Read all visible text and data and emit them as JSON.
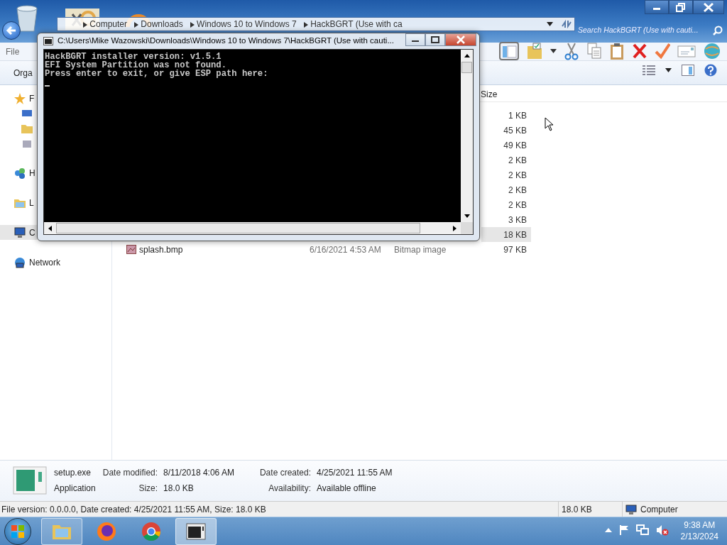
{
  "explorer": {
    "breadcrumb": [
      "Computer",
      "Downloads",
      "Windows 10 to Windows 7",
      "HackBGRT (Use with ca"
    ],
    "search": {
      "placeholder": "Search HackBGRT (Use with cauti..."
    },
    "menu": [
      "File"
    ],
    "toolbar": {
      "organize": "Orga"
    },
    "sidebar": [
      {
        "label": "F",
        "kind": "favorites",
        "selected": false
      },
      {
        "label": "H",
        "kind": "homegroup",
        "selected": false
      },
      {
        "label": "L",
        "kind": "libraries",
        "selected": false
      },
      {
        "label": "C",
        "kind": "computer",
        "selected": true
      },
      {
        "label": "Network",
        "kind": "network",
        "selected": false
      }
    ],
    "columns": [
      "Size"
    ],
    "rows": [
      {
        "size": "1 KB",
        "selected": false
      },
      {
        "size": "45 KB",
        "selected": false
      },
      {
        "size": "49 KB",
        "selected": false
      },
      {
        "size": "2 KB",
        "selected": false
      },
      {
        "size": "2 KB",
        "selected": false
      },
      {
        "size": "2 KB",
        "selected": false
      },
      {
        "size": "2 KB",
        "selected": false
      },
      {
        "size": "3 KB",
        "selected": false
      },
      {
        "size": "18 KB",
        "selected": true
      },
      {
        "name": "splash.bmp",
        "date": "6/16/2021 4:53 AM",
        "type": "Bitmap image",
        "size": "97 KB",
        "selected": false
      }
    ],
    "details": {
      "name": "setup.exe",
      "type": "Application",
      "fields": [
        {
          "label": "Date modified:",
          "value": "8/11/2018 4:06 AM"
        },
        {
          "label": "Size:",
          "value": "18.0 KB"
        },
        {
          "label": "Date created:",
          "value": "4/25/2021 11:55 AM"
        },
        {
          "label": "Availability:",
          "value": "Available offline"
        }
      ]
    },
    "status_bar": {
      "text": "File version: 0.0.0.0, Date created: 4/25/2021 11:55 AM, Size: 18.0 KB",
      "size": "18.0 KB",
      "zone": "Computer"
    }
  },
  "console": {
    "title": "C:\\Users\\Mike Wazowski\\Downloads\\Windows 10 to Windows 7\\HackBGRT (Use with cauti...",
    "lines": [
      "HackBGRT installer version: v1.5.1",
      "EFI System Partition was not found.",
      "Press enter to exit, or give ESP path here:"
    ]
  },
  "taskbar": {
    "apps": [
      {
        "kind": "explorer",
        "running": true,
        "selected": false
      },
      {
        "kind": "firefox",
        "running": false,
        "selected": false
      },
      {
        "kind": "chrome",
        "running": false,
        "selected": false
      },
      {
        "kind": "console",
        "running": true,
        "selected": true
      }
    ],
    "clock": {
      "time": "9:38 AM",
      "date": "2/13/2024"
    }
  }
}
